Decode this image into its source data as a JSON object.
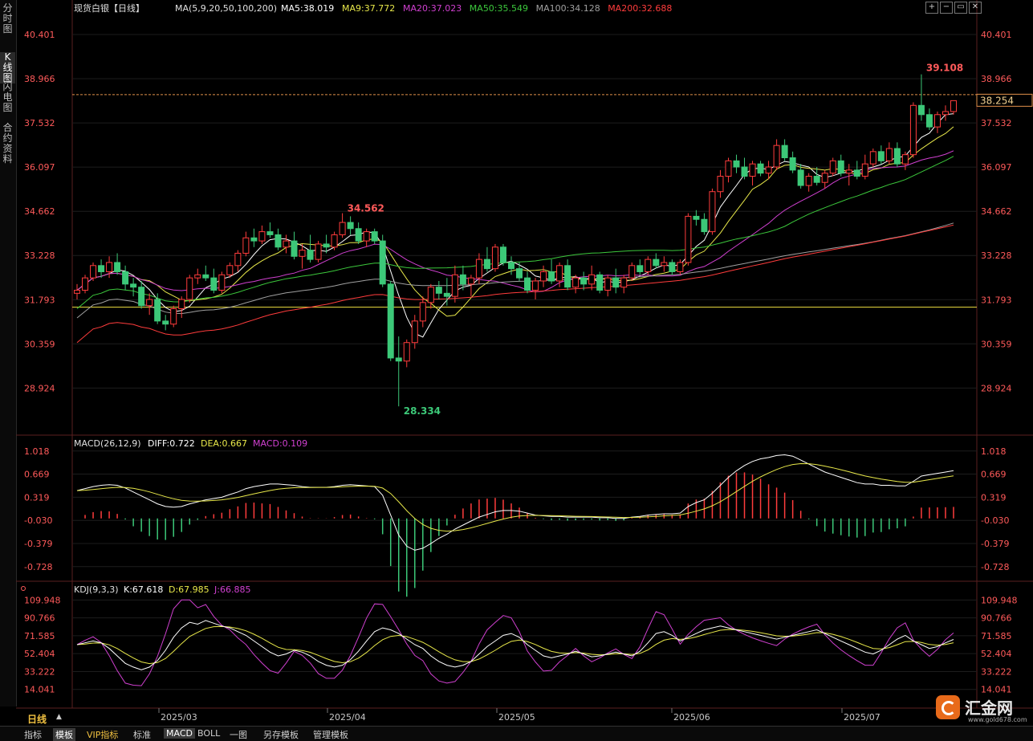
{
  "sidebar": {
    "tabs": [
      {
        "label": "分时图",
        "active": false
      },
      {
        "label": "K线图",
        "active": true
      },
      {
        "label": "闪电图",
        "active": false
      },
      {
        "label": "合约资料",
        "active": false
      }
    ]
  },
  "header": {
    "title": "现货白银【日线】",
    "ma_label": "MA(5,9,20,50,100,200)",
    "ma_values": [
      {
        "text": "MA5:38.019",
        "color": "#ffffff"
      },
      {
        "text": "MA9:37.772",
        "color": "#e8e84a"
      },
      {
        "text": "MA20:37.023",
        "color": "#d040d0"
      },
      {
        "text": "MA50:35.549",
        "color": "#3cc83c"
      },
      {
        "text": "MA100:34.128",
        "color": "#a0a0a0"
      },
      {
        "text": "MA200:32.688",
        "color": "#ff3c3c"
      }
    ]
  },
  "window_buttons": [
    "+",
    "−",
    "▭",
    "✕"
  ],
  "main_panel": {
    "y_ticks": [
      "40.401",
      "38.966",
      "37.532",
      "36.097",
      "34.662",
      "33.228",
      "31.793",
      "30.359",
      "28.924"
    ],
    "current_price": "38.254",
    "annotations": {
      "high": "39.108",
      "mid_high": "34.562",
      "low": "28.334"
    }
  },
  "macd_panel": {
    "label": "MACD(26,12,9)",
    "diff": "DIFF:0.722",
    "dea": "DEA:0.667",
    "macd": "MACD:0.109",
    "y_ticks": [
      "1.018",
      "0.669",
      "0.319",
      "-0.030",
      "-0.379",
      "-0.728"
    ]
  },
  "kdj_panel": {
    "label": "KDJ(9,3,3)",
    "k": "K:67.618",
    "d": "D:67.985",
    "j": "J:66.885",
    "y_ticks": [
      "109.948",
      "90.766",
      "71.585",
      "52.404",
      "33.222",
      "14.041"
    ]
  },
  "x_axis": {
    "labels": [
      "2025/03",
      "2025/04",
      "2025/05",
      "2025/06",
      "2025/07"
    ]
  },
  "period": "日线",
  "bottom_bar": [
    "指标",
    "模板",
    "VIP指标",
    "标准",
    "MACD",
    "BOLL",
    "一图",
    "另存模板",
    "管理模板"
  ],
  "logo": {
    "name": "汇金网",
    "url": "www.gold678.com"
  },
  "colors": {
    "up": "#ff3c3c",
    "down": "#3cc878",
    "axis_text": "#ff5a5a"
  },
  "chart_data": {
    "type": "candlestick",
    "price_range": [
      27.5,
      41.0
    ],
    "candles": [
      [
        32.0,
        32.3,
        31.8,
        32.1
      ],
      [
        32.1,
        32.6,
        32.0,
        32.5
      ],
      [
        32.5,
        33.0,
        32.4,
        32.9
      ],
      [
        32.9,
        33.1,
        32.5,
        32.7
      ],
      [
        32.7,
        33.2,
        32.5,
        33.0
      ],
      [
        33.0,
        33.3,
        32.6,
        32.7
      ],
      [
        32.7,
        32.9,
        32.1,
        32.3
      ],
      [
        32.3,
        32.5,
        31.9,
        32.2
      ],
      [
        32.2,
        32.4,
        31.5,
        31.6
      ],
      [
        31.6,
        32.0,
        31.3,
        31.8
      ],
      [
        31.8,
        32.0,
        31.0,
        31.1
      ],
      [
        31.1,
        31.3,
        30.8,
        31.0
      ],
      [
        31.0,
        31.6,
        30.9,
        31.5
      ],
      [
        31.5,
        31.9,
        31.2,
        31.8
      ],
      [
        31.8,
        32.6,
        31.7,
        32.5
      ],
      [
        32.5,
        32.8,
        32.3,
        32.6
      ],
      [
        32.6,
        32.9,
        32.4,
        32.5
      ],
      [
        32.5,
        32.8,
        32.0,
        32.1
      ],
      [
        32.1,
        32.7,
        32.0,
        32.6
      ],
      [
        32.6,
        33.0,
        32.5,
        32.9
      ],
      [
        32.9,
        33.4,
        32.7,
        33.3
      ],
      [
        33.3,
        34.0,
        33.2,
        33.8
      ],
      [
        33.8,
        34.1,
        33.5,
        33.7
      ],
      [
        33.7,
        34.2,
        33.6,
        34.0
      ],
      [
        34.0,
        34.3,
        33.8,
        33.9
      ],
      [
        33.9,
        34.1,
        33.4,
        33.5
      ],
      [
        33.5,
        33.9,
        33.3,
        33.7
      ],
      [
        33.7,
        34.0,
        33.1,
        33.2
      ],
      [
        33.2,
        33.6,
        32.8,
        33.4
      ],
      [
        33.4,
        33.9,
        33.0,
        33.1
      ],
      [
        33.1,
        33.7,
        33.0,
        33.6
      ],
      [
        33.6,
        33.9,
        33.3,
        33.5
      ],
      [
        33.5,
        34.0,
        33.4,
        33.9
      ],
      [
        33.9,
        34.6,
        33.8,
        34.3
      ],
      [
        34.3,
        34.5,
        33.9,
        34.1
      ],
      [
        34.1,
        34.3,
        33.6,
        33.7
      ],
      [
        33.7,
        34.1,
        33.5,
        34.0
      ],
      [
        34.0,
        34.1,
        33.6,
        33.7
      ],
      [
        33.7,
        33.9,
        32.2,
        32.3
      ],
      [
        32.3,
        32.4,
        29.8,
        29.9
      ],
      [
        29.9,
        30.6,
        28.33,
        29.8
      ],
      [
        29.8,
        30.5,
        29.6,
        30.4
      ],
      [
        30.4,
        31.3,
        30.2,
        31.1
      ],
      [
        31.1,
        31.9,
        30.9,
        31.7
      ],
      [
        31.7,
        32.3,
        31.5,
        32.2
      ],
      [
        32.2,
        32.4,
        31.8,
        32.0
      ],
      [
        32.0,
        32.5,
        31.6,
        31.9
      ],
      [
        31.9,
        32.9,
        31.7,
        32.6
      ],
      [
        32.6,
        32.9,
        32.1,
        32.3
      ],
      [
        32.3,
        32.6,
        31.9,
        32.5
      ],
      [
        32.5,
        33.3,
        32.3,
        33.1
      ],
      [
        33.1,
        33.5,
        32.7,
        32.8
      ],
      [
        32.8,
        33.6,
        32.7,
        33.5
      ],
      [
        33.5,
        33.6,
        32.9,
        33.0
      ],
      [
        33.0,
        33.2,
        32.6,
        32.8
      ],
      [
        32.8,
        33.0,
        32.4,
        32.5
      ],
      [
        32.5,
        32.7,
        32.0,
        32.1
      ],
      [
        32.1,
        32.5,
        31.8,
        32.4
      ],
      [
        32.4,
        32.9,
        32.2,
        32.7
      ],
      [
        32.7,
        33.1,
        32.3,
        32.4
      ],
      [
        32.4,
        33.0,
        32.2,
        32.9
      ],
      [
        32.9,
        33.1,
        32.1,
        32.2
      ],
      [
        32.2,
        32.6,
        32.0,
        32.5
      ],
      [
        32.5,
        32.7,
        32.1,
        32.3
      ],
      [
        32.3,
        32.9,
        32.1,
        32.6
      ],
      [
        32.6,
        32.7,
        32.0,
        32.1
      ],
      [
        32.1,
        32.6,
        31.9,
        32.5
      ],
      [
        32.5,
        32.8,
        32.0,
        32.2
      ],
      [
        32.2,
        32.6,
        32.0,
        32.5
      ],
      [
        32.5,
        33.0,
        32.4,
        32.9
      ],
      [
        32.9,
        33.1,
        32.6,
        32.7
      ],
      [
        32.7,
        33.2,
        32.6,
        33.1
      ],
      [
        33.1,
        33.3,
        32.8,
        32.9
      ],
      [
        32.9,
        33.2,
        32.7,
        33.0
      ],
      [
        33.0,
        33.1,
        32.6,
        32.7
      ],
      [
        32.7,
        33.1,
        32.6,
        33.0
      ],
      [
        33.0,
        34.6,
        32.9,
        34.5
      ],
      [
        34.5,
        34.7,
        34.2,
        34.4
      ],
      [
        34.4,
        34.6,
        33.9,
        34.0
      ],
      [
        34.0,
        35.4,
        33.9,
        35.3
      ],
      [
        35.3,
        36.0,
        35.1,
        35.8
      ],
      [
        35.8,
        36.4,
        35.6,
        36.3
      ],
      [
        36.3,
        36.5,
        35.9,
        36.1
      ],
      [
        36.1,
        36.4,
        35.7,
        35.8
      ],
      [
        35.8,
        36.3,
        35.5,
        36.2
      ],
      [
        36.2,
        36.3,
        35.8,
        35.9
      ],
      [
        35.9,
        36.3,
        35.7,
        36.1
      ],
      [
        36.1,
        37.0,
        36.0,
        36.8
      ],
      [
        36.8,
        37.0,
        36.3,
        36.4
      ],
      [
        36.4,
        36.6,
        35.9,
        36.0
      ],
      [
        36.0,
        36.2,
        35.4,
        35.5
      ],
      [
        35.5,
        35.9,
        35.3,
        35.8
      ],
      [
        35.8,
        36.1,
        35.5,
        35.6
      ],
      [
        35.6,
        36.0,
        35.4,
        35.9
      ],
      [
        35.9,
        36.4,
        35.8,
        36.3
      ],
      [
        36.3,
        36.5,
        35.8,
        35.9
      ],
      [
        35.9,
        36.2,
        35.5,
        36.0
      ],
      [
        36.0,
        36.3,
        35.7,
        35.8
      ],
      [
        35.8,
        36.5,
        35.7,
        36.2
      ],
      [
        36.2,
        36.7,
        36.1,
        36.6
      ],
      [
        36.6,
        36.8,
        36.2,
        36.3
      ],
      [
        36.3,
        36.9,
        36.2,
        36.7
      ],
      [
        36.7,
        36.9,
        36.1,
        36.2
      ],
      [
        36.2,
        36.6,
        36.0,
        36.5
      ],
      [
        36.5,
        38.2,
        36.4,
        38.1
      ],
      [
        38.1,
        39.108,
        37.6,
        37.8
      ],
      [
        37.8,
        38.0,
        37.3,
        37.4
      ],
      [
        37.4,
        37.9,
        37.2,
        37.8
      ],
      [
        37.8,
        38.1,
        37.6,
        37.9
      ],
      [
        37.9,
        38.2,
        37.8,
        38.254
      ]
    ],
    "macd": [
      0.42,
      0.45,
      0.48,
      0.5,
      0.51,
      0.5,
      0.46,
      0.4,
      0.34,
      0.28,
      0.22,
      0.18,
      0.17,
      0.18,
      0.22,
      0.25,
      0.28,
      0.3,
      0.32,
      0.36,
      0.4,
      0.45,
      0.48,
      0.5,
      0.52,
      0.52,
      0.51,
      0.5,
      0.48,
      0.47,
      0.47,
      0.47,
      0.48,
      0.5,
      0.51,
      0.5,
      0.49,
      0.48,
      0.35,
      0.05,
      -0.25,
      -0.42,
      -0.48,
      -0.45,
      -0.38,
      -0.3,
      -0.24,
      -0.16,
      -0.1,
      -0.04,
      0.02,
      0.06,
      0.1,
      0.12,
      0.12,
      0.11,
      0.08,
      0.05,
      0.04,
      0.03,
      0.03,
      0.02,
      0.02,
      0.02,
      0.02,
      0.01,
      0.01,
      0.0,
      0.0,
      0.02,
      0.03,
      0.05,
      0.06,
      0.07,
      0.07,
      0.08,
      0.18,
      0.24,
      0.28,
      0.38,
      0.5,
      0.62,
      0.72,
      0.8,
      0.86,
      0.9,
      0.92,
      0.95,
      0.96,
      0.94,
      0.88,
      0.82,
      0.76,
      0.7,
      0.66,
      0.62,
      0.58,
      0.54,
      0.52,
      0.52,
      0.5,
      0.5,
      0.49,
      0.49,
      0.56,
      0.64,
      0.66,
      0.68,
      0.7,
      0.722
    ],
    "kdj_k": [
      62,
      64,
      66,
      64,
      58,
      50,
      42,
      38,
      35,
      38,
      45,
      56,
      70,
      80,
      86,
      84,
      88,
      85,
      82,
      80,
      76,
      72,
      66,
      60,
      54,
      50,
      52,
      56,
      54,
      50,
      44,
      40,
      38,
      40,
      46,
      55,
      66,
      76,
      80,
      78,
      74,
      68,
      62,
      58,
      50,
      44,
      40,
      38,
      40,
      44,
      52,
      60,
      66,
      72,
      74,
      70,
      62,
      56,
      50,
      48,
      50,
      52,
      55,
      52,
      49,
      50,
      52,
      54,
      52,
      50,
      55,
      64,
      74,
      76,
      72,
      66,
      70,
      74,
      78,
      80,
      82,
      80,
      78,
      76,
      74,
      72,
      70,
      68,
      70,
      72,
      74,
      76,
      78,
      74,
      70,
      66,
      62,
      58,
      54,
      52,
      56,
      62,
      68,
      72,
      66,
      62,
      58,
      60,
      64,
      67.6
    ]
  }
}
